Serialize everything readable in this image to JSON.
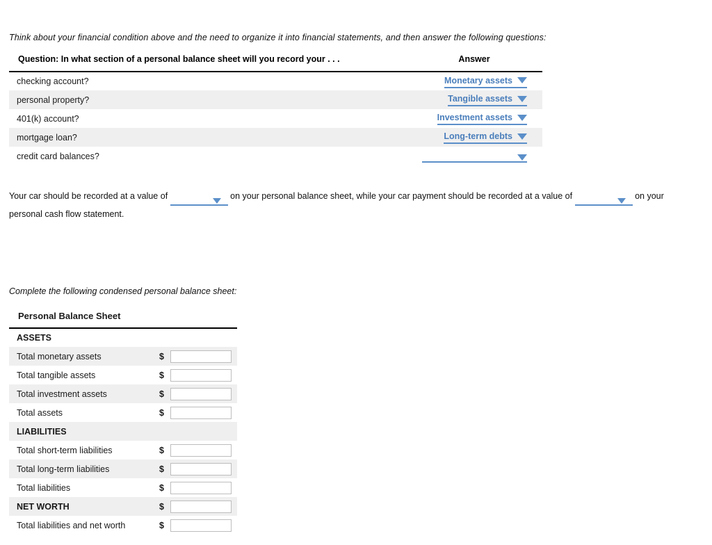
{
  "intro_prompt": "Think about your financial condition above and the need to organize it into financial statements, and then answer the following questions:",
  "question_table": {
    "headers": {
      "question": "Question: In what section of a personal balance sheet will you record your . . .",
      "answer": "Answer"
    },
    "rows": [
      {
        "question": "checking account?",
        "answer": "Monetary assets"
      },
      {
        "question": "personal property?",
        "answer": "Tangible assets"
      },
      {
        "question": "401(k) account?",
        "answer": "Investment assets"
      },
      {
        "question": "mortgage loan?",
        "answer": "Long-term debts"
      },
      {
        "question": "credit card balances?",
        "answer": ""
      }
    ]
  },
  "paragraph": {
    "part1": "Your car should be recorded at a value of",
    "dropdown1_value": "",
    "part2": "on your personal balance sheet, while your car payment should be recorded at a value of",
    "dropdown2_value": "",
    "part3": "on your personal cash flow statement."
  },
  "balance_sheet_intro": "Complete the following condensed personal balance sheet:",
  "balance_sheet": {
    "title": "Personal Balance Sheet",
    "currency_symbol": "$",
    "rows": [
      {
        "label": "ASSETS",
        "type": "section",
        "has_input": false,
        "value": ""
      },
      {
        "label": "Total monetary assets",
        "type": "item",
        "has_input": true,
        "value": ""
      },
      {
        "label": "Total tangible assets",
        "type": "item",
        "has_input": true,
        "value": ""
      },
      {
        "label": "Total investment assets",
        "type": "item",
        "has_input": true,
        "value": ""
      },
      {
        "label": "Total assets",
        "type": "item",
        "has_input": true,
        "value": ""
      },
      {
        "label": "LIABILITIES",
        "type": "section",
        "has_input": false,
        "value": ""
      },
      {
        "label": "Total short-term liabilities",
        "type": "item",
        "has_input": true,
        "value": ""
      },
      {
        "label": "Total long-term liabilities",
        "type": "item",
        "has_input": true,
        "value": ""
      },
      {
        "label": "Total liabilities",
        "type": "item",
        "has_input": true,
        "value": ""
      },
      {
        "label": "NET WORTH",
        "type": "section",
        "has_input": true,
        "value": ""
      },
      {
        "label": "Total liabilities and net worth",
        "type": "item",
        "has_input": true,
        "value": ""
      }
    ]
  },
  "colors": {
    "dropdown_blue": "#4a7ebb",
    "dropdown_underline": "#5b8fc9",
    "row_shade": "#efefef",
    "input_border": "#bdbdbd"
  }
}
